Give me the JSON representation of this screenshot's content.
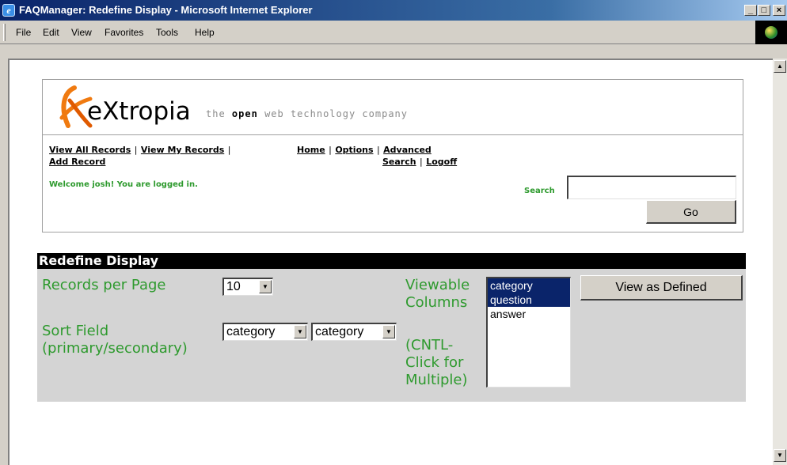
{
  "window": {
    "title": "FAQManager: Redefine Display - Microsoft Internet Explorer",
    "controls": {
      "minimize": "_",
      "maximize": "□",
      "close": "×"
    }
  },
  "menu": [
    "File",
    "Edit",
    "View",
    "Favorites",
    "Tools",
    "Help"
  ],
  "logo": {
    "wordmark": "eXtropia",
    "tagline_pre": "the",
    "tagline_bold": "open",
    "tagline_post": "web technology company"
  },
  "nav": {
    "view_all": "View All Records",
    "view_my": "View My Records",
    "add_record": "Add Record",
    "home": "Home",
    "options": "Options",
    "advanced": "Advanced",
    "search": "Search",
    "logoff": "Logoff",
    "separator": "|"
  },
  "welcome": "Welcome josh! You are logged in.",
  "search": {
    "label": "Search",
    "value": "",
    "button": "Go"
  },
  "redefine": {
    "header": "Redefine Display",
    "records_label": "Records per Page",
    "records_value": "10",
    "sort_label_1": "Sort Field",
    "sort_label_2": "(primary/secondary)",
    "sort_primary": "category",
    "sort_secondary": "category",
    "viewable_label_1": "Viewable",
    "viewable_label_2": "Columns",
    "cntl_1": "(CNTL-",
    "cntl_2": "Click for",
    "cntl_3": "Multiple)",
    "columns": [
      {
        "label": "category",
        "selected": true
      },
      {
        "label": "question",
        "selected": true
      },
      {
        "label": "answer",
        "selected": false
      }
    ],
    "view_button": "View as Defined"
  },
  "colors": {
    "accent_green": "#2e9a2e",
    "selection_blue": "#0a246a",
    "logo_orange": "#f07a10"
  },
  "icons": {
    "app": "ie-page-icon",
    "logo_mark": "extropia-x-logo",
    "dropdown": "chevron-down-icon",
    "scroll_up": "scroll-up-arrow-icon",
    "scroll_down": "scroll-down-arrow-icon"
  }
}
